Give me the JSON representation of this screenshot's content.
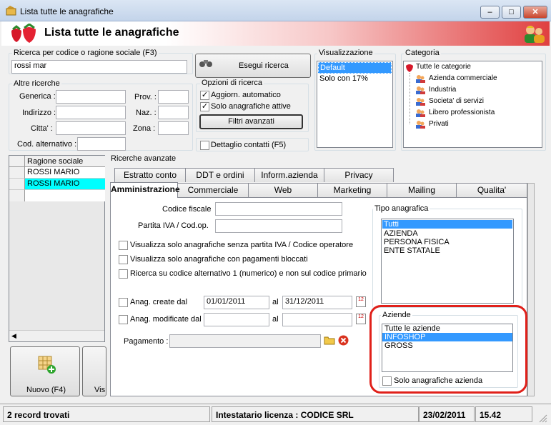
{
  "window": {
    "title": "Lista tutte le anagrafiche",
    "minimize": "–",
    "maximize": "□",
    "close": "✕"
  },
  "header": {
    "title": "Lista tutte le anagrafiche"
  },
  "search": {
    "label": "Ricerca per codice o ragione sociale (F3)",
    "value": "rossi mar",
    "button": "Esegui ricerca"
  },
  "altre": {
    "label": "Altre ricerche",
    "generica": "Generica :",
    "indirizzo": "Indirizzo :",
    "citta": "Citta' :",
    "cod_alt": "Cod. alternativo :",
    "prov": "Prov. :",
    "naz": "Naz. :",
    "zona": "Zona :"
  },
  "opzioni": {
    "label": "Opzioni di ricerca",
    "aggiorn": "Aggiorn. automatico",
    "solo_attive": "Solo anagrafiche attive",
    "filtri": "Filtri avanzati",
    "dettaglio": "Dettaglio contatti (F5)",
    "check": "✓"
  },
  "visualizzazione": {
    "label": "Visualizzazione",
    "items": [
      "Default",
      "Solo con 17%"
    ]
  },
  "categoria": {
    "label": "Categoria",
    "root": "Tutte le categorie",
    "items": [
      "Azienda commerciale",
      "Industria",
      "Societa' di servizi",
      "Libero professionista",
      "Privati"
    ]
  },
  "results": {
    "header": "Ragione sociale",
    "rows": [
      "ROSSI MARIO",
      "ROSSI MARIO"
    ]
  },
  "ricerche_avanzate": {
    "label": "Ricerche avanzate"
  },
  "tabs_back": [
    "Estratto conto",
    "DDT e ordini",
    "Inform.azienda",
    "Privacy"
  ],
  "tabs_front": [
    "Amministrazione",
    "Commerciale",
    "Web",
    "Marketing",
    "Mailing",
    "Qualita'"
  ],
  "amministrazione": {
    "codice_fiscale": "Codice fiscale",
    "partita_iva": "Partita IVA / Cod.op.",
    "chk1": "Visualizza solo anagrafiche senza partita IVA / Codice operatore",
    "chk2": "Visualizza solo anagrafiche con pagamenti bloccati",
    "chk3": "Ricerca su codice alternativo 1 (numerico)  e non sul codice primario",
    "create_label": "Anag. create dal",
    "create_from": "01/01/2011",
    "create_to": "31/12/2011",
    "modificate_label": "Anag. modificate dal",
    "al": "al",
    "pagamento": "Pagamento :",
    "cal_text": "12"
  },
  "tipo_anagrafica": {
    "label": "Tipo anagrafica",
    "items": [
      "Tutti",
      "AZIENDA",
      "PERSONA FISICA",
      "ENTE STATALE"
    ]
  },
  "aziende": {
    "label": "Aziende",
    "items": [
      "Tutte le aziende",
      "INFOSHOP",
      "GROSS"
    ],
    "solo": "Solo anagrafiche azienda"
  },
  "bottom": {
    "nuovo": "Nuovo (F4)",
    "vis": "Vis"
  },
  "status": {
    "records": "2 record trovati",
    "licenza": "Intestatario licenza : CODICE SRL",
    "date": "23/02/2011",
    "time": "15.42"
  },
  "colors": {
    "highlight_row": "#00ffff",
    "selection": "#3399ff",
    "annotation": "#e0201a"
  }
}
